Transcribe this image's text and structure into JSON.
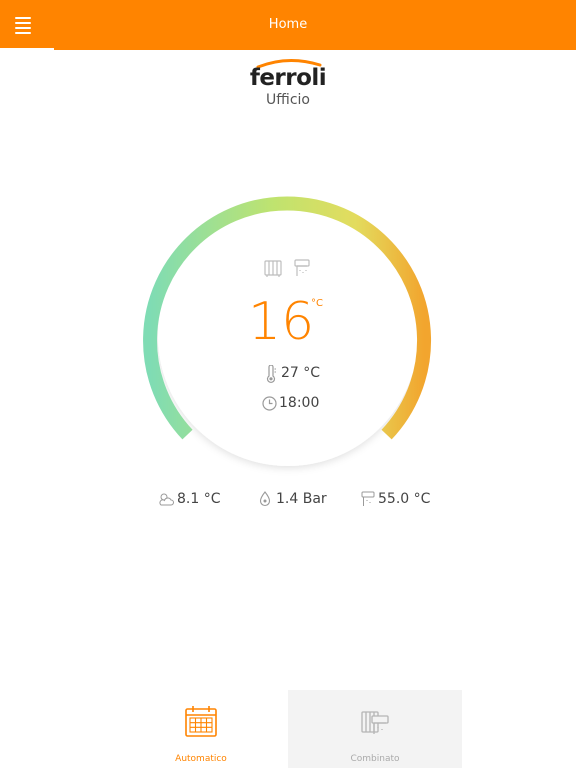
{
  "header": {
    "title": "Home",
    "menu_icon": "hamburger-menu-icon",
    "background_color": "#ff8400"
  },
  "brand": {
    "logo_text": "ferroli",
    "room_name": "Ufficio"
  },
  "thermostat": {
    "set_temperature": "16",
    "set_temperature_unit": "°C",
    "room_temperature": "27 °C",
    "schedule_time": "18:00",
    "mode_icons": [
      "radiator-icon",
      "tap-icon"
    ],
    "accent_color": "#ff8400",
    "arc_gradient": [
      "#7fdcb4",
      "#cde36a",
      "#f2a52e"
    ]
  },
  "stats": {
    "outdoor_temp": "8.1 °C",
    "pressure": "1.4 Bar",
    "water_temp": "55.0 °C"
  },
  "tabs": [
    {
      "label": "Automatico",
      "icon": "calendar-icon",
      "active": true
    },
    {
      "label": "Combinato",
      "icon": "radiator-tap-icon",
      "active": false
    }
  ]
}
